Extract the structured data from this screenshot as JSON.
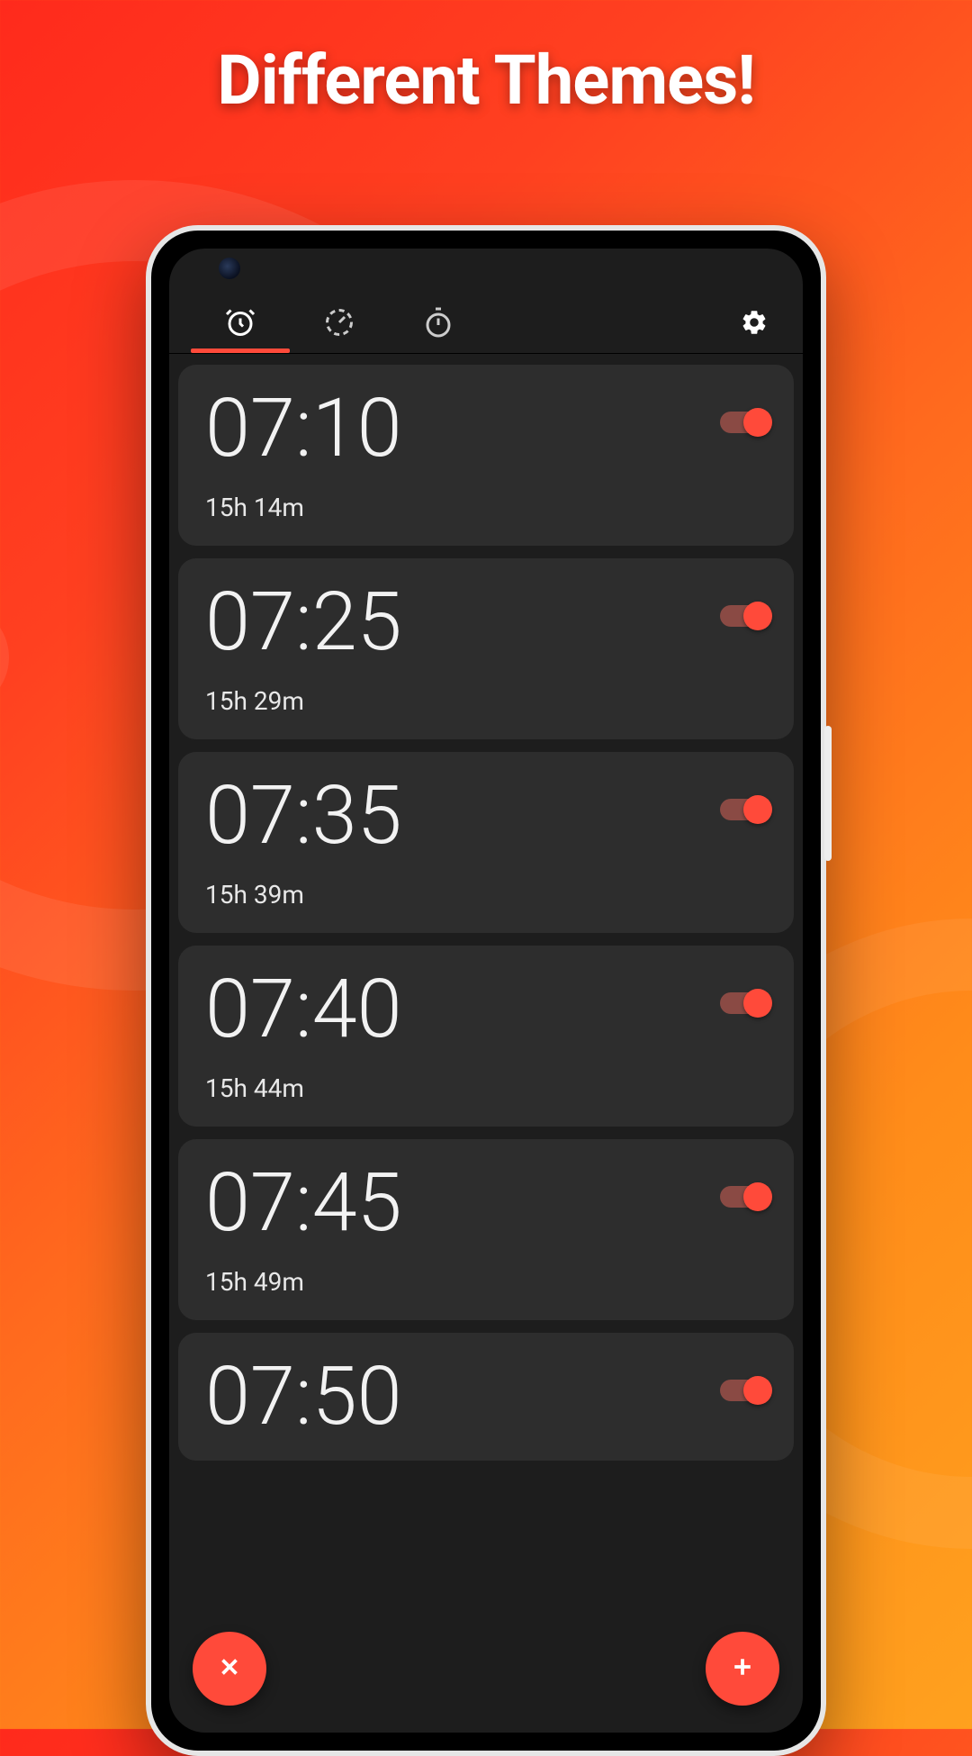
{
  "headline": "Different Themes!",
  "tabs": {
    "alarm_icon": "alarm-clock-icon",
    "timer_icon": "timer-icon",
    "stopwatch_icon": "stopwatch-icon",
    "settings_icon": "gear-icon"
  },
  "alarms": [
    {
      "time": "07:10",
      "remaining": "15h 14m",
      "enabled": true
    },
    {
      "time": "07:25",
      "remaining": "15h 29m",
      "enabled": true
    },
    {
      "time": "07:35",
      "remaining": "15h 39m",
      "enabled": true
    },
    {
      "time": "07:40",
      "remaining": "15h 44m",
      "enabled": true
    },
    {
      "time": "07:45",
      "remaining": "15h 49m",
      "enabled": true
    },
    {
      "time": "07:50",
      "remaining": "",
      "enabled": true
    }
  ],
  "fab": {
    "close": "×",
    "add": "+"
  },
  "colors": {
    "accent": "#ff4a3a",
    "card": "#2d2d2d",
    "screen": "#1d1d1d"
  }
}
